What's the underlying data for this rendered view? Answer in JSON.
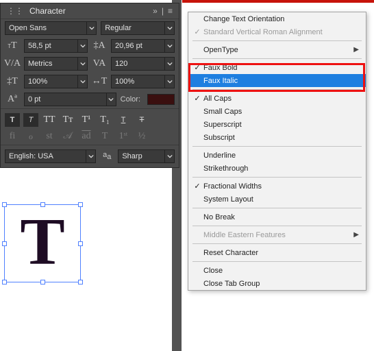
{
  "panel": {
    "title": "Character",
    "font_family": "Open Sans",
    "font_style": "Regular",
    "font_size": "58,5 pt",
    "leading": "20,96 pt",
    "kerning": "Metrics",
    "tracking": "120",
    "vscale": "100%",
    "hscale": "100%",
    "baseline": "0 pt",
    "color_label": "Color:",
    "color_hex": "#3a0f0f",
    "language": "English: USA",
    "aa": "Sharp"
  },
  "menu": {
    "items": [
      {
        "label": "Change Text Orientation"
      },
      {
        "label": "Standard Vertical Roman Alignment",
        "checked": true,
        "disabled": true
      },
      {
        "sep": true
      },
      {
        "label": "OpenType",
        "submenu": true
      },
      {
        "sep": true
      },
      {
        "label": "Faux Bold",
        "checked": true
      },
      {
        "label": "Faux Italic",
        "hover": true
      },
      {
        "sep": true
      },
      {
        "label": "All Caps",
        "checked": true
      },
      {
        "label": "Small Caps"
      },
      {
        "label": "Superscript"
      },
      {
        "label": "Subscript"
      },
      {
        "sep": true
      },
      {
        "label": "Underline"
      },
      {
        "label": "Strikethrough"
      },
      {
        "sep": true
      },
      {
        "label": "Fractional Widths",
        "checked": true
      },
      {
        "label": "System Layout"
      },
      {
        "sep": true
      },
      {
        "label": "No Break"
      },
      {
        "sep": true
      },
      {
        "label": "Middle Eastern Features",
        "submenu": true,
        "disabled": true
      },
      {
        "sep": true
      },
      {
        "label": "Reset Character"
      },
      {
        "sep": true
      },
      {
        "label": "Close"
      },
      {
        "label": "Close Tab Group"
      }
    ]
  }
}
